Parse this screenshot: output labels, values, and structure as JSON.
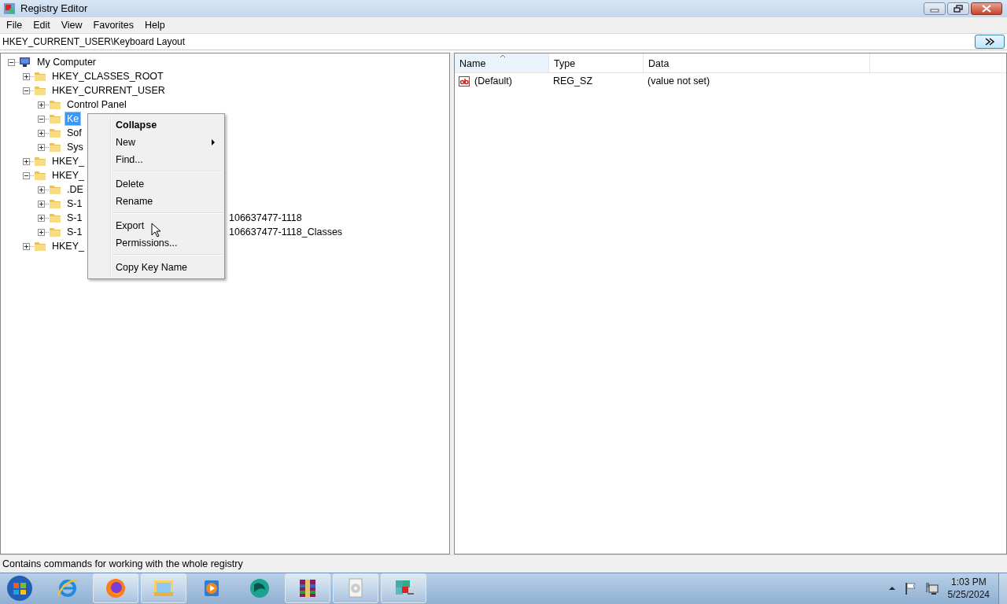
{
  "window": {
    "title": "Registry Editor"
  },
  "menu_bar": [
    "File",
    "Edit",
    "View",
    "Favorites",
    "Help"
  ],
  "address": "HKEY_CURRENT_USER\\Keyboard Layout",
  "tree": [
    {
      "label": "My Computer",
      "kind": "computer",
      "expanded": true,
      "children": [
        {
          "label": "HKEY_CLASSES_ROOT",
          "kind": "folder",
          "expanded": false
        },
        {
          "label": "HKEY_CURRENT_USER",
          "kind": "folder",
          "expanded": true,
          "children": [
            {
              "label": "Control Panel",
              "kind": "folder",
              "expanded": false
            },
            {
              "label": "Ke",
              "kind": "folder",
              "expanded": true,
              "selected": true
            },
            {
              "label": "Sof",
              "kind": "folder",
              "expanded": false
            },
            {
              "label": "Sys",
              "kind": "folder",
              "expanded": false
            }
          ]
        },
        {
          "label": "HKEY_",
          "kind": "folder",
          "expanded": false
        },
        {
          "label": "HKEY_",
          "kind": "folder",
          "expanded": true,
          "children": [
            {
              "label": ".DE",
              "kind": "folder",
              "expanded": false
            },
            {
              "label": "S-1",
              "kind": "folder",
              "expanded": false
            },
            {
              "label": "S-1",
              "tail": "106637477-1118",
              "kind": "folder",
              "expanded": false
            },
            {
              "label": "S-1",
              "tail": "106637477-1118_Classes",
              "kind": "folder",
              "expanded": false
            }
          ]
        },
        {
          "label": "HKEY_",
          "kind": "folder",
          "expanded": false
        }
      ]
    }
  ],
  "context_menu": [
    {
      "kind": "item",
      "label": "Collapse",
      "default": true,
      "submenu": false
    },
    {
      "kind": "item",
      "label": "New",
      "default": false,
      "submenu": true
    },
    {
      "kind": "item",
      "label": "Find...",
      "default": false,
      "submenu": false
    },
    {
      "kind": "separator"
    },
    {
      "kind": "item",
      "label": "Delete",
      "default": false,
      "submenu": false
    },
    {
      "kind": "item",
      "label": "Rename",
      "default": false,
      "submenu": false
    },
    {
      "kind": "separator"
    },
    {
      "kind": "item",
      "label": "Export",
      "default": false,
      "submenu": false
    },
    {
      "kind": "item",
      "label": "Permissions...",
      "default": false,
      "submenu": false
    },
    {
      "kind": "separator"
    },
    {
      "kind": "item",
      "label": "Copy Key Name",
      "default": false,
      "submenu": false
    }
  ],
  "values": {
    "columns": [
      "Name",
      "Type",
      "Data"
    ],
    "rows": [
      {
        "name": "(Default)",
        "type": "REG_SZ",
        "data": "(value not set)"
      }
    ]
  },
  "status_bar": "Contains commands for working with the whole registry",
  "taskbar": {
    "apps": [
      {
        "kind": "ie",
        "running": false
      },
      {
        "kind": "firefox",
        "running": true
      },
      {
        "kind": "explorer",
        "running": true
      },
      {
        "kind": "media",
        "running": false
      },
      {
        "kind": "teal",
        "running": false
      },
      {
        "kind": "archive",
        "running": true
      },
      {
        "kind": "disc",
        "running": true
      },
      {
        "kind": "registry",
        "running": true
      }
    ],
    "time": "1:03 PM",
    "date": "5/25/2024"
  }
}
